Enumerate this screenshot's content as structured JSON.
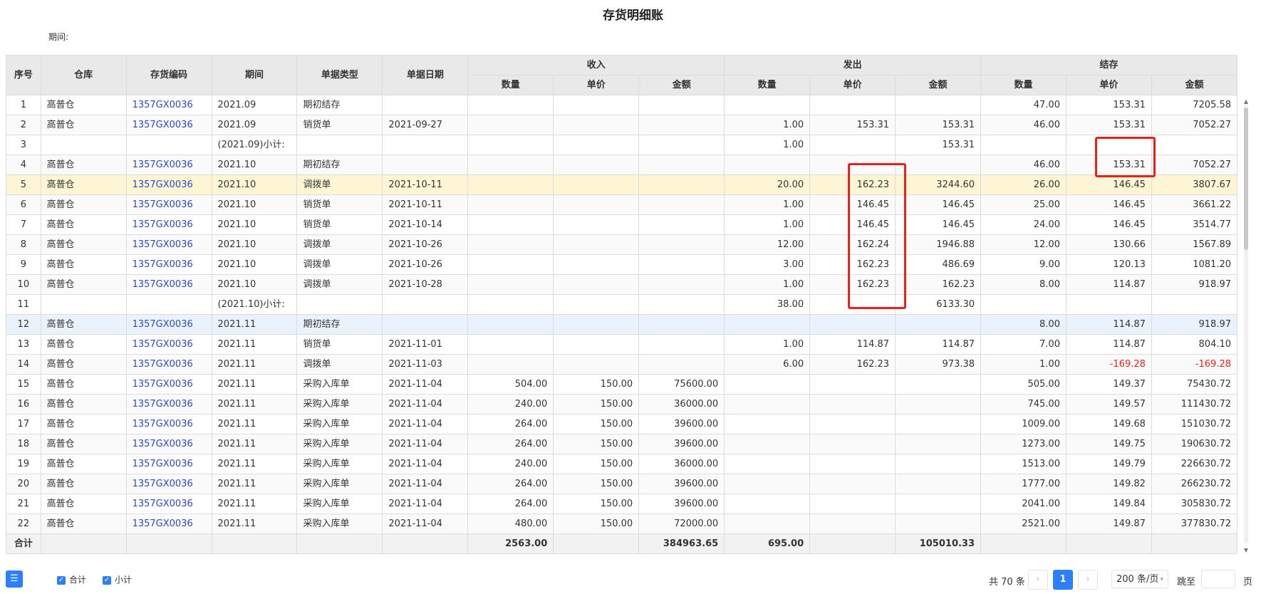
{
  "title": "存货明细账",
  "period_label": "期间:",
  "headers": {
    "seq": "序号",
    "warehouse": "仓库",
    "code": "存货编码",
    "period": "期间",
    "doc_type": "单据类型",
    "doc_date": "单据日期",
    "income": "收入",
    "issue": "发出",
    "balance": "结存",
    "qty": "数量",
    "price": "单价",
    "amount": "金额"
  },
  "rows": [
    {
      "seq": "1",
      "wh": "高普仓",
      "code": "1357GX0036",
      "period": "2021.09",
      "type": "期初结存",
      "date": "",
      "in_qty": "",
      "in_price": "",
      "in_amt": "",
      "out_qty": "",
      "out_price": "",
      "out_amt": "",
      "bal_qty": "47.00",
      "bal_price": "153.31",
      "bal_amt": "7205.58",
      "style": ""
    },
    {
      "seq": "2",
      "wh": "高普仓",
      "code": "1357GX0036",
      "period": "2021.09",
      "type": "销货单",
      "date": "2021-09-27",
      "in_qty": "",
      "in_price": "",
      "in_amt": "",
      "out_qty": "1.00",
      "out_price": "153.31",
      "out_amt": "153.31",
      "bal_qty": "46.00",
      "bal_price": "153.31",
      "bal_amt": "7052.27",
      "style": "alt"
    },
    {
      "seq": "3",
      "wh": "",
      "code": "",
      "period": "(2021.09)小计:",
      "type": "",
      "date": "",
      "in_qty": "",
      "in_price": "",
      "in_amt": "",
      "out_qty": "1.00",
      "out_price": "",
      "out_amt": "153.31",
      "bal_qty": "",
      "bal_price": "",
      "bal_amt": "",
      "style": ""
    },
    {
      "seq": "4",
      "wh": "高普仓",
      "code": "1357GX0036",
      "period": "2021.10",
      "type": "期初结存",
      "date": "",
      "in_qty": "",
      "in_price": "",
      "in_amt": "",
      "out_qty": "",
      "out_price": "",
      "out_amt": "",
      "bal_qty": "46.00",
      "bal_price": "153.31",
      "bal_amt": "7052.27",
      "style": "alt"
    },
    {
      "seq": "5",
      "wh": "高普仓",
      "code": "1357GX0036",
      "period": "2021.10",
      "type": "调拨单",
      "date": "2021-10-11",
      "in_qty": "",
      "in_price": "",
      "in_amt": "",
      "out_qty": "20.00",
      "out_price": "162.23",
      "out_amt": "3244.60",
      "bal_qty": "26.00",
      "bal_price": "146.45",
      "bal_amt": "3807.67",
      "style": "highlight"
    },
    {
      "seq": "6",
      "wh": "高普仓",
      "code": "1357GX0036",
      "period": "2021.10",
      "type": "销货单",
      "date": "2021-10-11",
      "in_qty": "",
      "in_price": "",
      "in_amt": "",
      "out_qty": "1.00",
      "out_price": "146.45",
      "out_amt": "146.45",
      "bal_qty": "25.00",
      "bal_price": "146.45",
      "bal_amt": "3661.22",
      "style": "alt"
    },
    {
      "seq": "7",
      "wh": "高普仓",
      "code": "1357GX0036",
      "period": "2021.10",
      "type": "销货单",
      "date": "2021-10-14",
      "in_qty": "",
      "in_price": "",
      "in_amt": "",
      "out_qty": "1.00",
      "out_price": "146.45",
      "out_amt": "146.45",
      "bal_qty": "24.00",
      "bal_price": "146.45",
      "bal_amt": "3514.77",
      "style": ""
    },
    {
      "seq": "8",
      "wh": "高普仓",
      "code": "1357GX0036",
      "period": "2021.10",
      "type": "调拨单",
      "date": "2021-10-26",
      "in_qty": "",
      "in_price": "",
      "in_amt": "",
      "out_qty": "12.00",
      "out_price": "162.24",
      "out_amt": "1946.88",
      "bal_qty": "12.00",
      "bal_price": "130.66",
      "bal_amt": "1567.89",
      "style": "alt"
    },
    {
      "seq": "9",
      "wh": "高普仓",
      "code": "1357GX0036",
      "period": "2021.10",
      "type": "调拨单",
      "date": "2021-10-26",
      "in_qty": "",
      "in_price": "",
      "in_amt": "",
      "out_qty": "3.00",
      "out_price": "162.23",
      "out_amt": "486.69",
      "bal_qty": "9.00",
      "bal_price": "120.13",
      "bal_amt": "1081.20",
      "style": ""
    },
    {
      "seq": "10",
      "wh": "高普仓",
      "code": "1357GX0036",
      "period": "2021.10",
      "type": "调拨单",
      "date": "2021-10-28",
      "in_qty": "",
      "in_price": "",
      "in_amt": "",
      "out_qty": "1.00",
      "out_price": "162.23",
      "out_amt": "162.23",
      "bal_qty": "8.00",
      "bal_price": "114.87",
      "bal_amt": "918.97",
      "style": "alt"
    },
    {
      "seq": "11",
      "wh": "",
      "code": "",
      "period": "(2021.10)小计:",
      "type": "",
      "date": "",
      "in_qty": "",
      "in_price": "",
      "in_amt": "",
      "out_qty": "38.00",
      "out_price": "",
      "out_amt": "6133.30",
      "bal_qty": "",
      "bal_price": "",
      "bal_amt": "",
      "style": ""
    },
    {
      "seq": "12",
      "wh": "高普仓",
      "code": "1357GX0036",
      "period": "2021.11",
      "type": "期初结存",
      "date": "",
      "in_qty": "",
      "in_price": "",
      "in_amt": "",
      "out_qty": "",
      "out_price": "",
      "out_amt": "",
      "bal_qty": "8.00",
      "bal_price": "114.87",
      "bal_amt": "918.97",
      "style": "selected"
    },
    {
      "seq": "13",
      "wh": "高普仓",
      "code": "1357GX0036",
      "period": "2021.11",
      "type": "销货单",
      "date": "2021-11-01",
      "in_qty": "",
      "in_price": "",
      "in_amt": "",
      "out_qty": "1.00",
      "out_price": "114.87",
      "out_amt": "114.87",
      "bal_qty": "7.00",
      "bal_price": "114.87",
      "bal_amt": "804.10",
      "style": ""
    },
    {
      "seq": "14",
      "wh": "高普仓",
      "code": "1357GX0036",
      "period": "2021.11",
      "type": "调拨单",
      "date": "2021-11-03",
      "in_qty": "",
      "in_price": "",
      "in_amt": "",
      "out_qty": "6.00",
      "out_price": "162.23",
      "out_amt": "973.38",
      "bal_qty": "1.00",
      "bal_price": "-169.28",
      "bal_amt": "-169.28",
      "style": "alt"
    },
    {
      "seq": "15",
      "wh": "高普仓",
      "code": "1357GX0036",
      "period": "2021.11",
      "type": "采购入库单",
      "date": "2021-11-04",
      "in_qty": "504.00",
      "in_price": "150.00",
      "in_amt": "75600.00",
      "out_qty": "",
      "out_price": "",
      "out_amt": "",
      "bal_qty": "505.00",
      "bal_price": "149.37",
      "bal_amt": "75430.72",
      "style": ""
    },
    {
      "seq": "16",
      "wh": "高普仓",
      "code": "1357GX0036",
      "period": "2021.11",
      "type": "采购入库单",
      "date": "2021-11-04",
      "in_qty": "240.00",
      "in_price": "150.00",
      "in_amt": "36000.00",
      "out_qty": "",
      "out_price": "",
      "out_amt": "",
      "bal_qty": "745.00",
      "bal_price": "149.57",
      "bal_amt": "111430.72",
      "style": "alt"
    },
    {
      "seq": "17",
      "wh": "高普仓",
      "code": "1357GX0036",
      "period": "2021.11",
      "type": "采购入库单",
      "date": "2021-11-04",
      "in_qty": "264.00",
      "in_price": "150.00",
      "in_amt": "39600.00",
      "out_qty": "",
      "out_price": "",
      "out_amt": "",
      "bal_qty": "1009.00",
      "bal_price": "149.68",
      "bal_amt": "151030.72",
      "style": ""
    },
    {
      "seq": "18",
      "wh": "高普仓",
      "code": "1357GX0036",
      "period": "2021.11",
      "type": "采购入库单",
      "date": "2021-11-04",
      "in_qty": "264.00",
      "in_price": "150.00",
      "in_amt": "39600.00",
      "out_qty": "",
      "out_price": "",
      "out_amt": "",
      "bal_qty": "1273.00",
      "bal_price": "149.75",
      "bal_amt": "190630.72",
      "style": "alt"
    },
    {
      "seq": "19",
      "wh": "高普仓",
      "code": "1357GX0036",
      "period": "2021.11",
      "type": "采购入库单",
      "date": "2021-11-04",
      "in_qty": "240.00",
      "in_price": "150.00",
      "in_amt": "36000.00",
      "out_qty": "",
      "out_price": "",
      "out_amt": "",
      "bal_qty": "1513.00",
      "bal_price": "149.79",
      "bal_amt": "226630.72",
      "style": ""
    },
    {
      "seq": "20",
      "wh": "高普仓",
      "code": "1357GX0036",
      "period": "2021.11",
      "type": "采购入库单",
      "date": "2021-11-04",
      "in_qty": "264.00",
      "in_price": "150.00",
      "in_amt": "39600.00",
      "out_qty": "",
      "out_price": "",
      "out_amt": "",
      "bal_qty": "1777.00",
      "bal_price": "149.82",
      "bal_amt": "266230.72",
      "style": "alt"
    },
    {
      "seq": "21",
      "wh": "高普仓",
      "code": "1357GX0036",
      "period": "2021.11",
      "type": "采购入库单",
      "date": "2021-11-04",
      "in_qty": "264.00",
      "in_price": "150.00",
      "in_amt": "39600.00",
      "out_qty": "",
      "out_price": "",
      "out_amt": "",
      "bal_qty": "2041.00",
      "bal_price": "149.84",
      "bal_amt": "305830.72",
      "style": ""
    },
    {
      "seq": "22",
      "wh": "高普仓",
      "code": "1357GX0036",
      "period": "2021.11",
      "type": "采购入库单",
      "date": "2021-11-04",
      "in_qty": "480.00",
      "in_price": "150.00",
      "in_amt": "72000.00",
      "out_qty": "",
      "out_price": "",
      "out_amt": "",
      "bal_qty": "2521.00",
      "bal_price": "149.87",
      "bal_amt": "377830.72",
      "style": "alt"
    }
  ],
  "totals": {
    "label": "合计",
    "in_qty": "2563.00",
    "in_amt": "384963.65",
    "out_qty": "695.00",
    "out_amt": "105010.33"
  },
  "footer": {
    "menu_icon": "list-menu-icon",
    "chk_total": "合计",
    "chk_subtotal": "小计",
    "total_count": "共 70 条",
    "prev": "‹",
    "current_page": "1",
    "next": "›",
    "page_size": "200 条/页",
    "goto_label": "跳至",
    "goto_value": "",
    "page_suffix": "页"
  },
  "colors": {
    "accent": "#2d7ff9",
    "code_link": "#2a48c6",
    "negative": "#e8211a",
    "annotation_box": "#e8211a",
    "highlight_row": "#fdf5d3",
    "selected_row": "#eaf3fc"
  }
}
